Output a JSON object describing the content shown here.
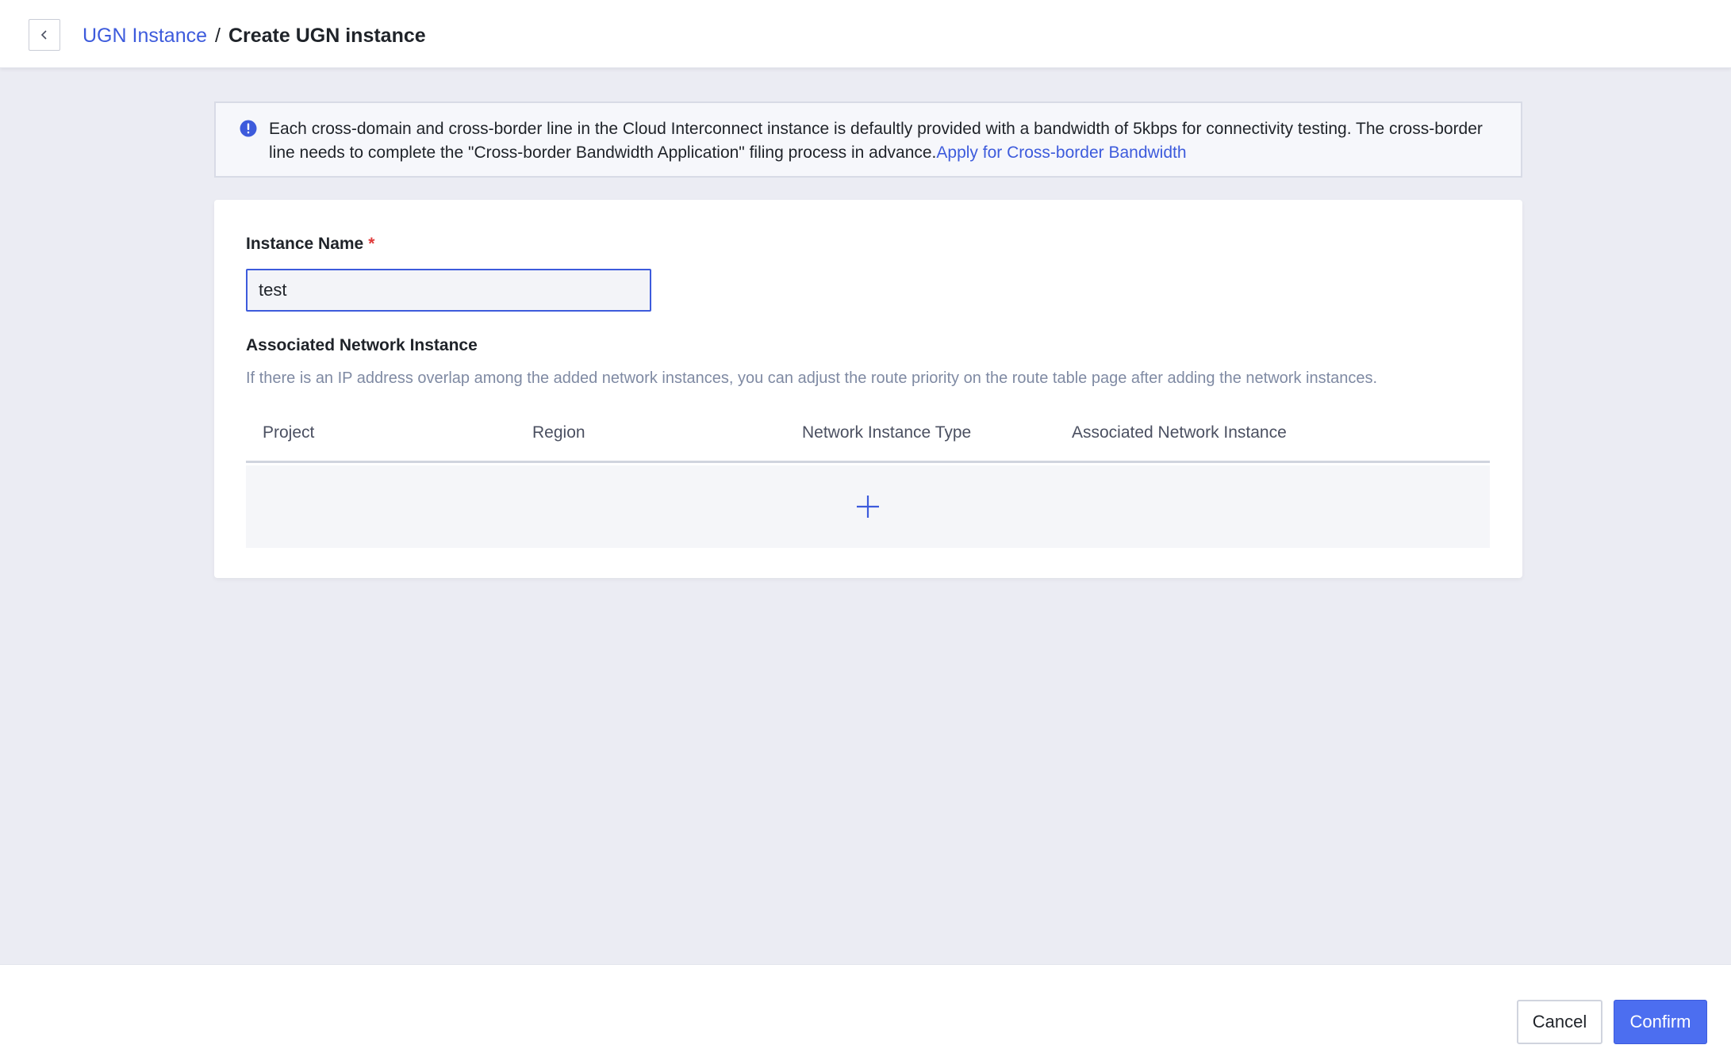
{
  "header": {
    "back_icon": "chevron-left-icon",
    "breadcrumb_parent": "UGN Instance",
    "breadcrumb_separator": "/",
    "breadcrumb_current": "Create UGN instance"
  },
  "notice": {
    "icon": "info-icon",
    "text": "Each cross-domain and cross-border line in the Cloud Interconnect instance is defaultly provided with a bandwidth of 5kbps for connectivity testing. The cross-border line needs to complete the \"Cross-border Bandwidth Application\" filing process in advance.",
    "link_text": "Apply for Cross-border Bandwidth"
  },
  "form": {
    "instance_name_label": "Instance Name",
    "required_mark": "*",
    "instance_name_value": "test",
    "network_section_title": "Associated Network Instance",
    "network_section_desc": "If there is an IP address overlap among the added network instances, you can adjust the route priority on the route table page after adding the network instances.",
    "table_columns": [
      "Project",
      "Region",
      "Network Instance Type",
      "Associated Network Instance"
    ],
    "add_icon": "plus-icon"
  },
  "footer": {
    "cancel_label": "Cancel",
    "confirm_label": "Confirm"
  },
  "colors": {
    "accent": "#3d5bdc",
    "confirm_bg": "#4c6ef0",
    "page_bg": "#ebecf3",
    "required": "#e03b3b"
  }
}
